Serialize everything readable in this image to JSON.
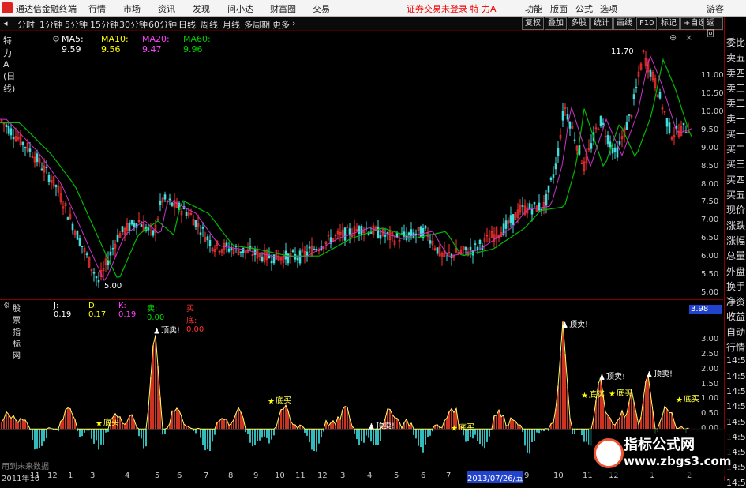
{
  "app": {
    "title": "通达信金融终端",
    "warning": "证券交易未登录 特 力A"
  },
  "top_menu": [
    "行情",
    "市场",
    "资讯",
    "发现",
    "问小达",
    "财富圈",
    "交易"
  ],
  "top_right_menu": [
    "功能",
    "版面",
    "公式",
    "选项",
    "游客"
  ],
  "period_tabs": [
    "分时",
    "1分钟",
    "5分钟",
    "15分钟",
    "30分钟",
    "60分钟",
    "日线",
    "周线",
    "月线",
    "多周期",
    "更多"
  ],
  "active_tab": "日线",
  "tool_buttons": [
    "复权",
    "叠加",
    "多股",
    "统计",
    "画线",
    "F10",
    "标记",
    "+自选",
    "返回"
  ],
  "main_chart": {
    "stock_label": "特 力A (日线)",
    "ma": [
      {
        "label": "MA5: 9.59",
        "color": "#ffffff"
      },
      {
        "label": "MA10: 9.56",
        "color": "#ffff00"
      },
      {
        "label": "MA20: 9.47",
        "color": "#ff44ff"
      },
      {
        "label": "MA60: 9.96",
        "color": "#00cc00"
      }
    ],
    "y_ticks": [
      "11.00",
      "10.50",
      "10.00",
      "9.50",
      "9.00",
      "8.50",
      "8.00",
      "7.50",
      "7.00",
      "6.50",
      "6.00",
      "5.50",
      "5.00"
    ],
    "y_range": [
      4.8,
      11.9
    ],
    "high_marker": "11.70",
    "low_marker": "5.00"
  },
  "indicator": {
    "name": "股票指标网",
    "j": "J: 0.19",
    "d": "D: 0.17",
    "k": "K: 0.19",
    "sell_label": "卖: 0.00",
    "buy_label": "买底: 0.00",
    "current_value": "3.98",
    "y_ticks": [
      "3.00",
      "2.50",
      "2.00",
      "1.50",
      "1.00",
      "0.50",
      "0.00"
    ],
    "y_range": [
      -1.4,
      3.9
    ],
    "signal_sell": "顶卖!",
    "signal_buy": "底买",
    "footer": "用到未来数据"
  },
  "x_axis": [
    "2011年10",
    "11",
    "12",
    "1",
    "3",
    "4",
    "5",
    "6",
    "7",
    "8",
    "9",
    "10",
    "11",
    "12",
    "3",
    "4",
    "5",
    "6",
    "7",
    "2013/07/26/五",
    "9",
    "10",
    "11",
    "12",
    "1",
    "2"
  ],
  "right_panel": [
    "委比",
    "卖五",
    "卖四",
    "卖三",
    "卖二",
    "卖一",
    "买一",
    "买二",
    "买三",
    "买四",
    "买五",
    "现价",
    "涨跌",
    "涨幅",
    "总量",
    "外盘",
    "换手",
    "净资",
    "收益",
    "自动",
    "行情",
    "14:5",
    "14:5",
    "14:5",
    "14:5",
    "14:5",
    "14:5",
    "14:5",
    "14:5",
    "14:5"
  ],
  "watermark": {
    "line1": "指标公式网",
    "line2": "www.zbgs3.com"
  }
}
